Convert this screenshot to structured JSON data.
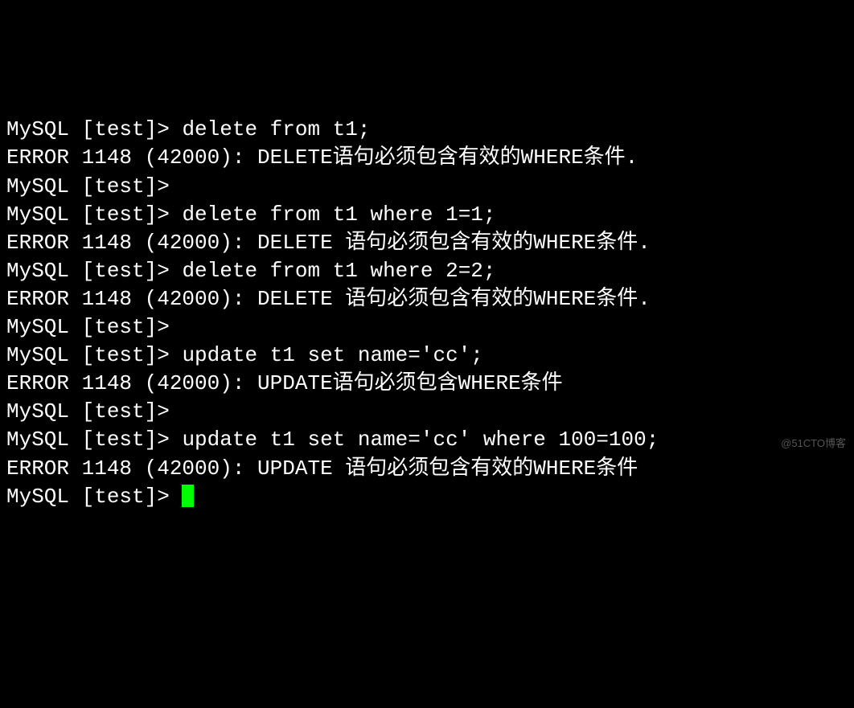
{
  "terminal": {
    "prompt": "MySQL [test]> ",
    "lines": [
      {
        "type": "prompt",
        "cmd": "delete from t1;"
      },
      {
        "type": "output",
        "text": "ERROR 1148 (42000): DELETE语句必须包含有效的WHERE条件."
      },
      {
        "type": "prompt",
        "cmd": ""
      },
      {
        "type": "prompt",
        "cmd": "delete from t1 where 1=1;"
      },
      {
        "type": "output",
        "text": "ERROR 1148 (42000): DELETE 语句必须包含有效的WHERE条件."
      },
      {
        "type": "prompt",
        "cmd": "delete from t1 where 2=2;"
      },
      {
        "type": "output",
        "text": "ERROR 1148 (42000): DELETE 语句必须包含有效的WHERE条件."
      },
      {
        "type": "prompt",
        "cmd": ""
      },
      {
        "type": "prompt",
        "cmd": "update t1 set name='cc';"
      },
      {
        "type": "output",
        "text": "ERROR 1148 (42000): UPDATE语句必须包含WHERE条件"
      },
      {
        "type": "prompt",
        "cmd": ""
      },
      {
        "type": "prompt",
        "cmd": "update t1 set name='cc' where 100=100;"
      },
      {
        "type": "output",
        "text": "ERROR 1148 (42000): UPDATE 语句必须包含有效的WHERE条件"
      },
      {
        "type": "prompt-cursor",
        "cmd": ""
      }
    ]
  },
  "watermark": "@51CTO博客"
}
